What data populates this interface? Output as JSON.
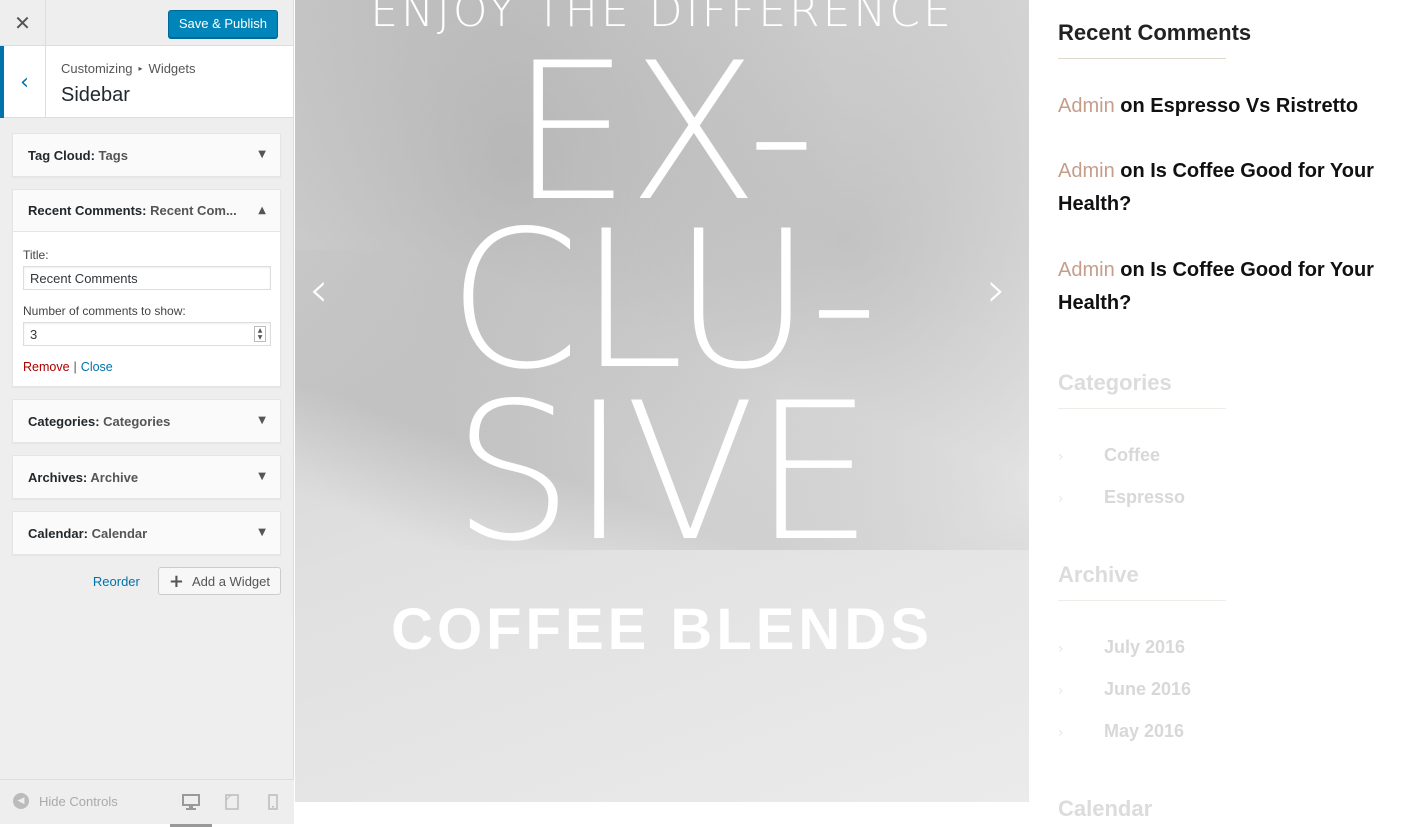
{
  "customizer": {
    "close_icon": "✕",
    "save_label": "Save & Publish",
    "back_icon": "‹",
    "breadcrumb": {
      "root": "Customizing",
      "sep": "▸",
      "current": "Widgets"
    },
    "section_title": "Sidebar"
  },
  "widgets": [
    {
      "title": "Tag Cloud:",
      "sub": "Tags",
      "arrow": "▼"
    },
    {
      "title": "Recent Comments:",
      "sub": "Recent Com...",
      "arrow": "▲"
    },
    {
      "title": "Categories:",
      "sub": "Categories",
      "arrow": "▼"
    },
    {
      "title": "Archives:",
      "sub": "Archive",
      "arrow": "▼"
    },
    {
      "title": "Calendar:",
      "sub": "Calendar",
      "arrow": "▼"
    }
  ],
  "recent_comments_form": {
    "title_label": "Title:",
    "title_value": "Recent Comments",
    "number_label": "Number of comments to show:",
    "number_value": "3",
    "remove_label": "Remove",
    "pipe": "|",
    "close_label": "Close"
  },
  "widget_actions": {
    "reorder_label": "Reorder",
    "add_icon": "+",
    "add_label": "Add a Widget"
  },
  "footer": {
    "hide_controls_label": "Hide Controls",
    "hide_icon": "◀"
  },
  "preview": {
    "hero_sub": "ENJOY THE DIFFERENCE",
    "hero_big": [
      "EX-",
      "CLU-",
      "SIVE"
    ],
    "hero_blend": "COFFEE BLENDS",
    "prev_arrow": "‹",
    "next_arrow": "›"
  },
  "sidebar_widgets": {
    "recent_comments_title": "Recent Comments",
    "comments": [
      {
        "author": "Admin",
        "on": " on ",
        "post": "Espresso Vs Ristretto"
      },
      {
        "author": "Admin",
        "on": " on ",
        "post": "Is Coffee Good for Your Health?"
      },
      {
        "author": "Admin",
        "on": " on ",
        "post": "Is Coffee Good for Your Health?"
      }
    ],
    "categories_title": "Categories",
    "categories": [
      "Coffee",
      "Espresso"
    ],
    "archive_title": "Archive",
    "archives": [
      "July 2016",
      "June 2016",
      "May 2016"
    ],
    "calendar_title": "Calendar",
    "chev": "›"
  },
  "colors": {
    "primary_blue": "#0085ba",
    "link_blue": "#0073aa",
    "remove_red": "#aa0000",
    "author_accent": "#c49e8b"
  }
}
